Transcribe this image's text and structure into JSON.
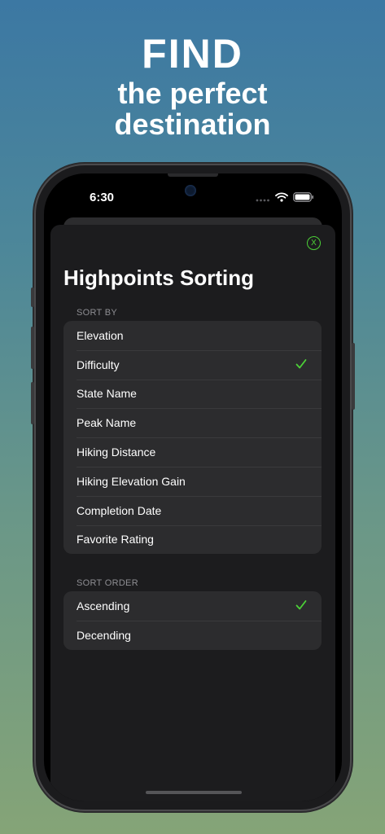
{
  "promo": {
    "line1": "FIND",
    "line2": "the perfect",
    "line3": "destination"
  },
  "status_bar": {
    "time": "6:30"
  },
  "sheet": {
    "title": "Highpoints Sorting",
    "close_icon": "X"
  },
  "sort_by": {
    "header": "SORT BY",
    "selected": "Difficulty",
    "options": [
      "Elevation",
      "Difficulty",
      "State Name",
      "Peak Name",
      "Hiking Distance",
      "Hiking Elevation Gain",
      "Completion Date",
      "Favorite Rating"
    ]
  },
  "sort_order": {
    "header": "SORT ORDER",
    "selected": "Ascending",
    "options": [
      "Ascending",
      "Decending"
    ]
  },
  "colors": {
    "accent": "#4cd137",
    "sheet_background": "#1c1c1e",
    "group_background": "#2c2c2e"
  }
}
